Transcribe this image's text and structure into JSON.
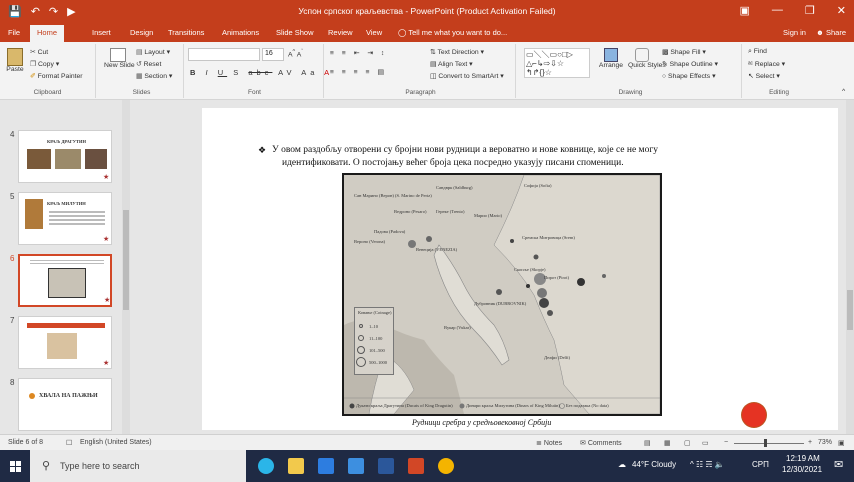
{
  "window": {
    "title": "Успон српског краљевства - PowerPoint (Product Activation Failed)",
    "quick_access": [
      "save-icon",
      "undo-icon",
      "redo-icon",
      "start-from-beginning-icon"
    ],
    "controls": [
      "minimize",
      "restore",
      "close"
    ]
  },
  "tabs": [
    "File",
    "Home",
    "Insert",
    "Design",
    "Transitions",
    "Animations",
    "Slide Show",
    "Review",
    "View"
  ],
  "active_tab": "Home",
  "tell_me": "Tell me what you want to do...",
  "sign_in": "Sign in",
  "share": "Share",
  "ribbon": {
    "clipboard": {
      "paste": "Paste",
      "cut": "Cut",
      "copy": "Copy",
      "format_painter": "Format Painter",
      "label": "Clipboard"
    },
    "slides": {
      "new_slide": "New Slide",
      "layout": "Layout",
      "reset": "Reset",
      "section": "Section",
      "label": "Slides"
    },
    "font": {
      "font_name": "",
      "font_size": "16",
      "label": "Font",
      "bold": "B",
      "italic": "I",
      "underline": "U",
      "shadow": "S",
      "strike": "abc",
      "spacing": "AV",
      "case": "Aa",
      "color": "A"
    },
    "paragraph": {
      "text_direction": "Text Direction",
      "align_text": "Align Text",
      "convert_smartart": "Convert to SmartArt",
      "label": "Paragraph"
    },
    "drawing": {
      "arrange": "Arrange",
      "quick_styles": "Quick Styles",
      "shape_fill": "Shape Fill",
      "shape_outline": "Shape Outline",
      "shape_effects": "Shape Effects",
      "label": "Drawing"
    },
    "editing": {
      "find": "Find",
      "replace": "Replace",
      "select": "Select",
      "label": "Editing"
    }
  },
  "thumbnails": [
    {
      "num": "4",
      "title": "КРАЉ ДРАГУТИН"
    },
    {
      "num": "5",
      "title": "КРАЉ МИЛУТИН"
    },
    {
      "num": "6",
      "title": ""
    },
    {
      "num": "7",
      "title": ""
    },
    {
      "num": "8",
      "title": "ХВАЛА НА ПАЖЊИ"
    }
  ],
  "slide": {
    "bullet_line1": "У овом раздобљу отворени су бројни нови рудници а вероватно и нове ковнице, које се не могу",
    "bullet_line2": "идентификовати. О постојању већег броја цека посредно указују писани споменици.",
    "caption": "Рудници сребра у средњовековној Србији",
    "map_labels": [
      "Сан Марино (Верон) (S. Marino de Pertz)",
      "Сандврк (Saldburg)",
      "Софија (Sofia)",
      "Ведроно (Pesaro)",
      "Гереке (Trento)",
      "Марио (Mario)",
      "Падова (Padova)",
      "Венеција (VENEZIA)",
      "Вероно (Verona)",
      "Сремска Митровица (Srem)",
      "Пирот (Pirot)",
      "Дубровник (DUBROVNIK)",
      "Скопље (Skopje)",
      "Вукар (Vukar)",
      "Делфи (Delfi)",
      "Дукати краља Драгутина (Ducats of King Dragutin)",
      "Динари краља Милутина (Dinars of King Milutin)",
      "Без података (No data)"
    ],
    "legend_title": "Ковање (Coinage)",
    "legend_items": [
      "1–10",
      "11–100",
      "101–500",
      "500–1000"
    ]
  },
  "status": {
    "slide_of": "Slide 6 of 8",
    "language": "English (United States)",
    "notes": "Notes",
    "comments": "Comments",
    "zoom": "73%"
  },
  "taskbar": {
    "search_placeholder": "Type here to search",
    "weather": "44°F Cloudy",
    "lang": "СРП",
    "time": "12:19 AM",
    "date": "12/30/2021"
  },
  "colors": {
    "accent": "#c43e1c",
    "taskbar": "#1f2a44",
    "selected_thumb_border": "#d24726",
    "red_circle": "#e53323"
  }
}
